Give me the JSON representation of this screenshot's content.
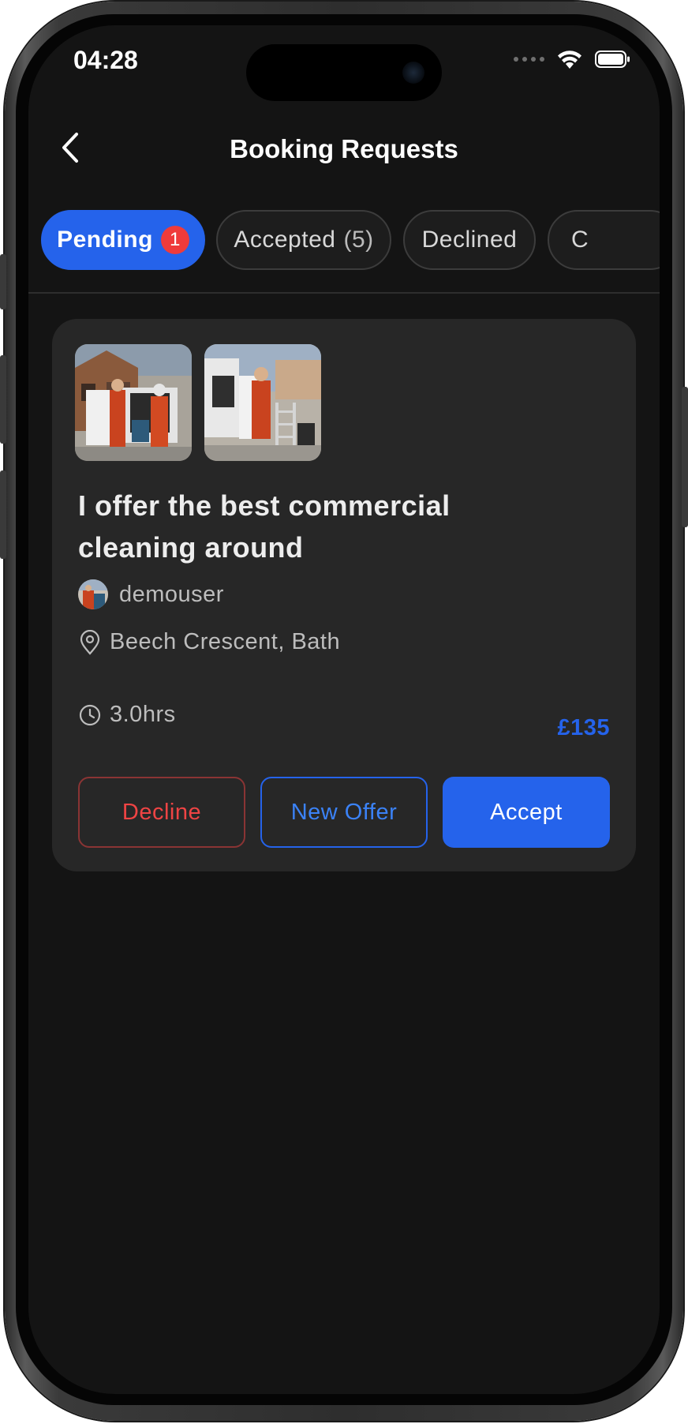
{
  "status_bar": {
    "time": "04:28"
  },
  "header": {
    "title": "Booking Requests"
  },
  "tabs": [
    {
      "label": "Pending",
      "badge": "1"
    },
    {
      "label": "Accepted",
      "count": "(5)"
    },
    {
      "label": "Declined"
    },
    {
      "label": "C"
    }
  ],
  "card": {
    "title": "I offer the best commercial cleaning around",
    "username": "demouser",
    "location": "Beech Crescent, Bath",
    "duration": "3.0hrs",
    "price": "£135",
    "buttons": {
      "decline": "Decline",
      "new_offer": "New Offer",
      "accept": "Accept"
    }
  },
  "colors": {
    "accent": "#2563eb",
    "badge": "#ef3b3b",
    "decline": "#ef4444",
    "background": "#141414",
    "card": "#272727"
  },
  "icons": [
    "back-chevron-icon",
    "location-pin-icon",
    "clock-icon",
    "wifi-icon",
    "battery-icon"
  ]
}
